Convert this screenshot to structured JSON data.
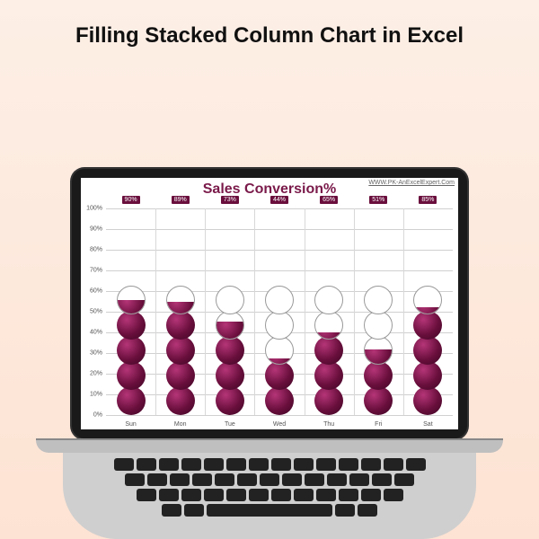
{
  "headline": "Filling Stacked Column Chart in Excel",
  "watermark": "WWW.PK-AnExcelExpert.Com",
  "chart_data": {
    "type": "bar",
    "title": "Sales Conversion%",
    "xlabel": "",
    "ylabel": "",
    "ylim": [
      0,
      100
    ],
    "yticks": [
      0,
      10,
      20,
      30,
      40,
      50,
      60,
      70,
      80,
      90,
      100
    ],
    "ytick_labels": [
      "0%",
      "10%",
      "20%",
      "30%",
      "40%",
      "50%",
      "60%",
      "70%",
      "80%",
      "90%",
      "100%"
    ],
    "categories": [
      "Sun",
      "Mon",
      "Tue",
      "Wed",
      "Thu",
      "Fri",
      "Sat"
    ],
    "values": [
      90,
      89,
      73,
      44,
      65,
      51,
      85
    ],
    "value_labels": [
      "90%",
      "89%",
      "73%",
      "44%",
      "65%",
      "51%",
      "85%"
    ]
  },
  "colors": {
    "accent": "#6a0f3d"
  }
}
